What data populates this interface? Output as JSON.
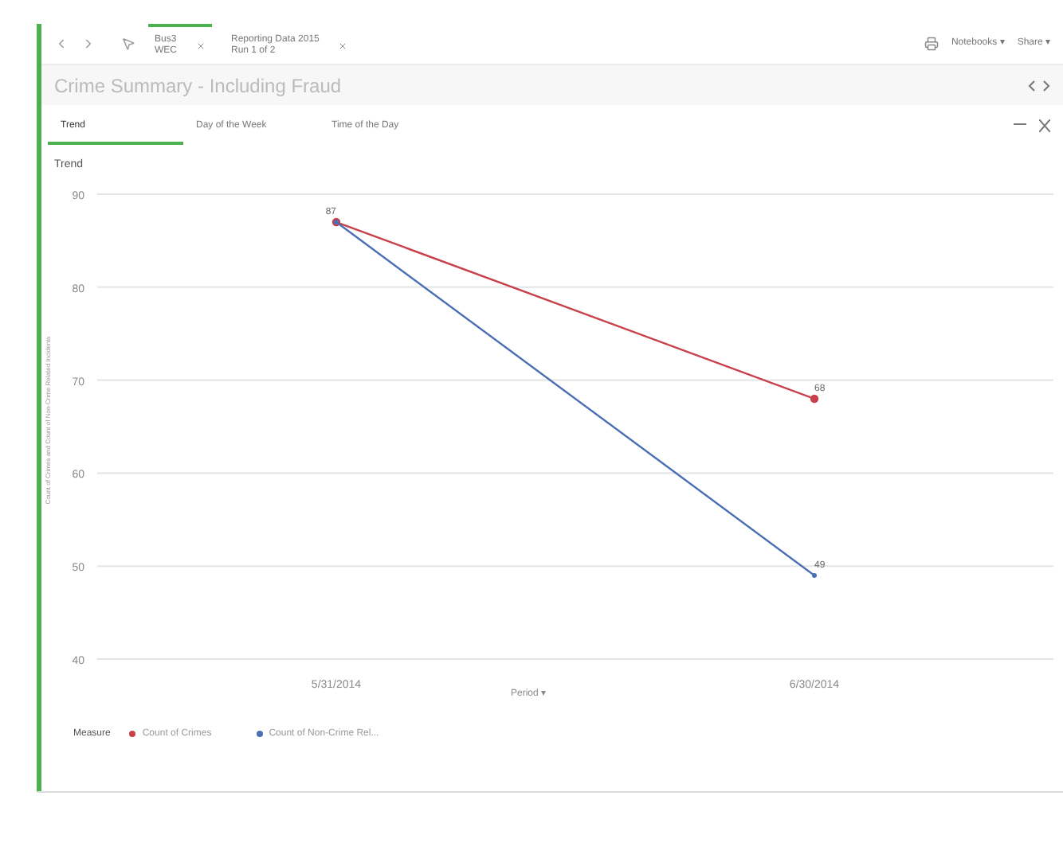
{
  "toolbar": {
    "breadcrumbs": [
      {
        "title": "Bus3",
        "subtitle": "WEC",
        "selected": true
      },
      {
        "title": "Reporting Data 2015",
        "subtitle": "Run 1 of 2",
        "selected": false
      }
    ],
    "buttons": [
      "Notebooks ▾",
      "Share ▾"
    ]
  },
  "title": "Crime Summary - Including Fraud",
  "tabs": [
    {
      "label": "Trend",
      "selected": true
    },
    {
      "label": "Day of the Week",
      "selected": false
    },
    {
      "label": "Time of the Day",
      "selected": false
    }
  ],
  "section_title": "Trend",
  "chart": {
    "chart_data": {
      "type": "line",
      "xlabel": "Period ▾",
      "ylabel": "Count of Crimes and Count of Non-Crime Related Incidents",
      "categories": [
        "5/31/2014",
        "6/30/2014"
      ],
      "series": [
        {
          "name": "Count of Crimes",
          "color": "#c8404a",
          "marker": "circle",
          "values": [
            87,
            68
          ]
        },
        {
          "name": "Count of Non-Crime Rel...",
          "color": "#4a6fb5",
          "marker": "circle",
          "values": [
            87,
            49
          ]
        }
      ],
      "ylim": [
        40,
        90
      ],
      "yticks": [
        40,
        50,
        60,
        70,
        80,
        90
      ],
      "grid": true,
      "value_labels": [
        [
          "87",
          "68"
        ],
        [
          null,
          "49"
        ]
      ]
    }
  },
  "legend": {
    "title": "Measure"
  }
}
